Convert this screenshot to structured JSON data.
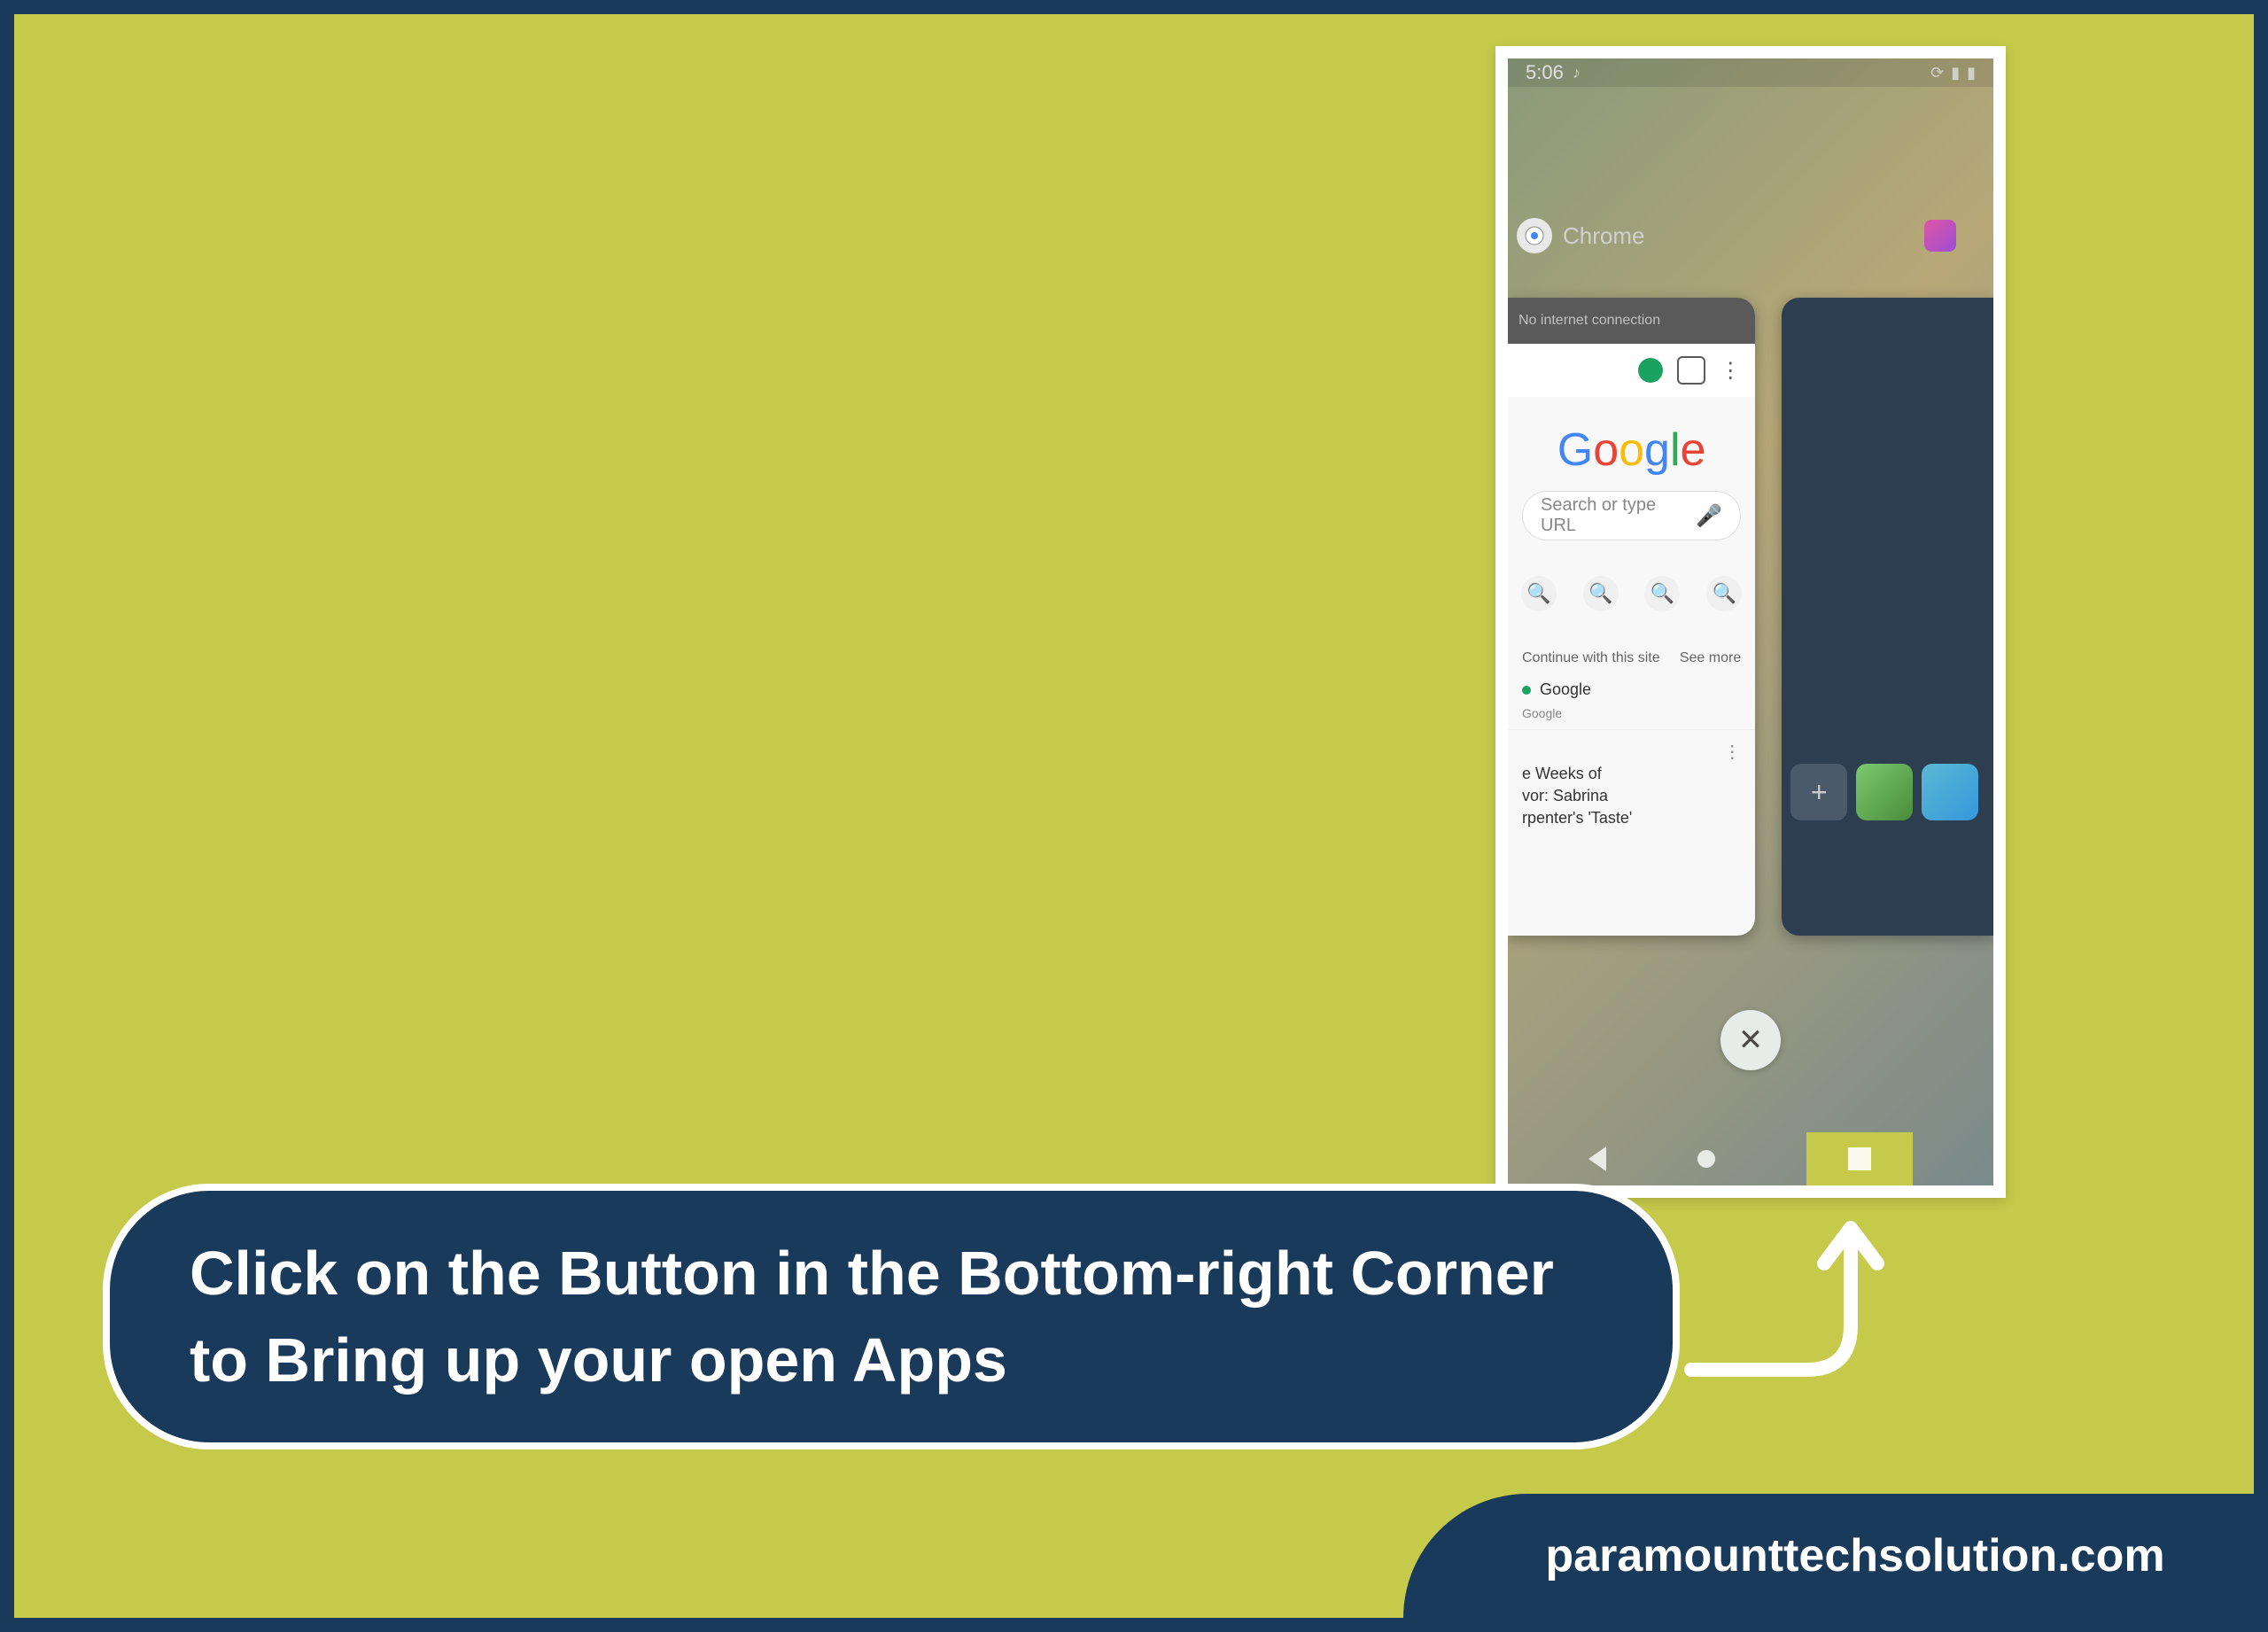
{
  "status_bar": {
    "time": "5:06",
    "music_icon": "♪"
  },
  "apps": {
    "chrome_label": "Chrome",
    "second_app_label": ""
  },
  "chrome": {
    "url_text": "No internet connection",
    "search_placeholder": "Search or type URL",
    "shortcut_labels": [
      "",
      "",
      "",
      ""
    ],
    "feed_header": "Continue with this site",
    "feed_see_more": "See more",
    "feed_item": "Google",
    "feed_sub": "Google",
    "article_header": "",
    "article_text1": "e Weeks of",
    "article_text2": "vor: Sabrina",
    "article_text3": "rpenter's 'Taste'"
  },
  "close_button": "✕",
  "instruction": "Click on the Button in the Bottom-right Corner to Bring up your open Apps",
  "footer": "paramounttechsolution.com"
}
